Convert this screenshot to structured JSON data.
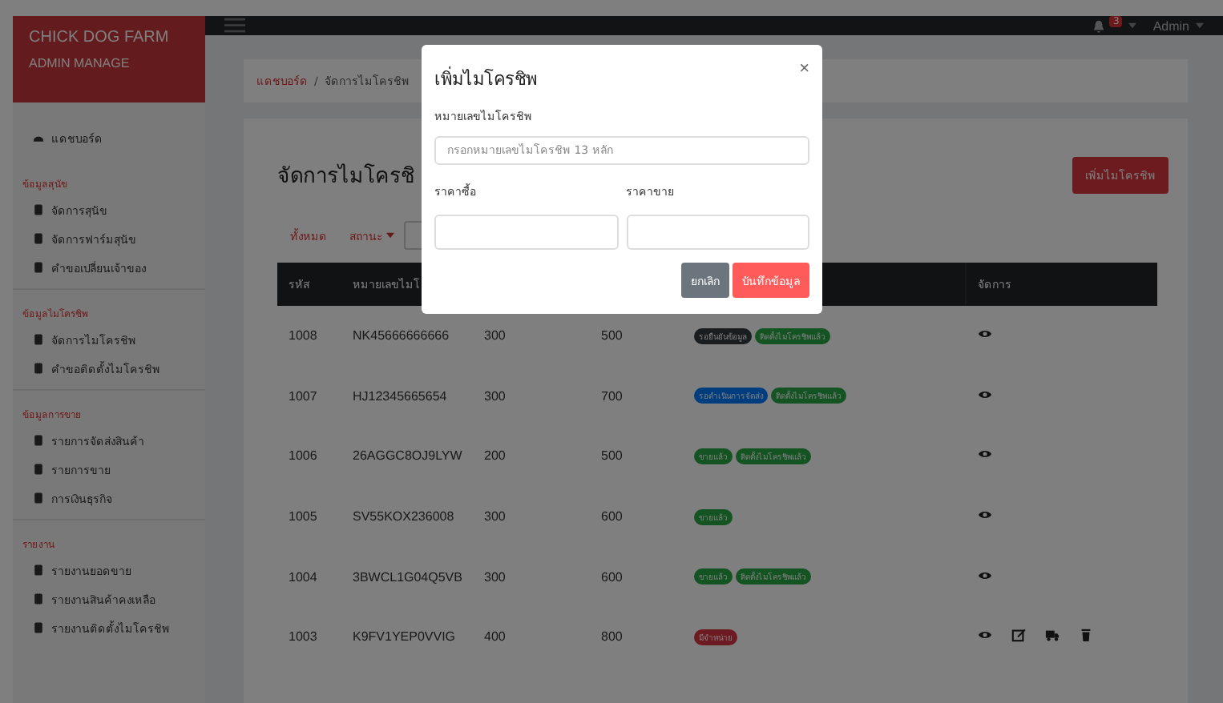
{
  "brand": {
    "title": "CHICK DOG FARM",
    "subtitle": "ADMIN MANAGE"
  },
  "sidebar": {
    "top_item": {
      "label": "แดชบอร์ด"
    },
    "sections": [
      {
        "heading": "ข้อมูลสุนัข",
        "items": [
          {
            "label": "จัดการสุนัข"
          },
          {
            "label": "จัดการฟาร์มสุนัข"
          },
          {
            "label": "คำขอเปลี่ยนเจ้าของ"
          }
        ]
      },
      {
        "heading": "ข้อมูลไมโครชิพ",
        "items": [
          {
            "label": "จัดการไมโครชิพ"
          },
          {
            "label": "คำขอติดตั้งไมโครชิพ"
          }
        ]
      },
      {
        "heading": "ข้อมูลการขาย",
        "items": [
          {
            "label": "รายการจัดส่งสินค้า"
          },
          {
            "label": "รายการขาย"
          },
          {
            "label": "การเงินธุรกิจ"
          }
        ]
      },
      {
        "heading": "รายงาน",
        "items": [
          {
            "label": "รายงานยอดขาย"
          },
          {
            "label": "รายงานสินค้าคงเหลือ"
          },
          {
            "label": "รายงานติดตั้งไมโครชิพ"
          }
        ]
      }
    ]
  },
  "topbar": {
    "notification_count": "3",
    "user": "Admin"
  },
  "breadcrumb": [
    {
      "label": "แดชบอร์ด",
      "link": true
    },
    {
      "separator": "/",
      "label": "จัดการไมโครชิพ",
      "link": false
    }
  ],
  "page": {
    "title": "จัดการไมโครชิ",
    "add_button": "เพิ่มไมโครชิพ",
    "filters": [
      {
        "label": "ทั้งหมด",
        "dropdown": false
      },
      {
        "label": "สถานะ",
        "dropdown": true
      }
    ]
  },
  "table": {
    "columns": [
      "รหัส",
      "หมายเลขไมโ",
      "",
      "",
      "",
      "จัดการ"
    ],
    "rows": [
      {
        "id": "1008",
        "chip": "NK45666666666",
        "buy": "300",
        "sell": "500",
        "badges": [
          {
            "label": "รอยืนยันข้อมูล",
            "color": "#1a1d20"
          },
          {
            "label": "ติดตั้งไมโครชิพแล้ว",
            "color": "#145322"
          }
        ],
        "actions": [
          {
            "kind": "view"
          }
        ]
      },
      {
        "id": "1007",
        "chip": "HJ12345665654",
        "buy": "300",
        "sell": "700",
        "badges": [
          {
            "label": "รอดำเนินการจัดส่ง",
            "color": "#003d7f"
          },
          {
            "label": "ติดตั้งไมโครชิพแล้ว",
            "color": "#145322"
          }
        ],
        "actions": [
          {
            "kind": "view"
          }
        ]
      },
      {
        "id": "1006",
        "chip": "26AGGC8OJ9LYW",
        "buy": "200",
        "sell": "500",
        "badges": [
          {
            "label": "ขายแล้ว",
            "color": "#145322"
          },
          {
            "label": "ติดตั้งไมโครชิพแล้ว",
            "color": "#145322"
          }
        ],
        "actions": [
          {
            "kind": "view"
          }
        ]
      },
      {
        "id": "1005",
        "chip": "SV55KOX236008",
        "buy": "300",
        "sell": "600",
        "badges": [
          {
            "label": "ขายแล้ว",
            "color": "#145322"
          }
        ],
        "actions": [
          {
            "kind": "view"
          }
        ]
      },
      {
        "id": "1004",
        "chip": "3BWCL1G04Q5VB",
        "buy": "300",
        "sell": "600",
        "badges": [
          {
            "label": "ขายแล้ว",
            "color": "#145322"
          },
          {
            "label": "ติดตั้งไมโครชิพแล้ว",
            "color": "#145322"
          }
        ],
        "actions": [
          {
            "kind": "view"
          }
        ]
      },
      {
        "id": "1003",
        "chip": "K9FV1YEP0VVIG",
        "buy": "400",
        "sell": "800",
        "badges": [
          {
            "label": "มีจำหน่าย",
            "color": "#6e1a22"
          }
        ],
        "actions": [
          {
            "kind": "view"
          },
          {
            "kind": "edit"
          },
          {
            "kind": "ship"
          },
          {
            "kind": "delete"
          }
        ]
      }
    ]
  },
  "modal": {
    "title": "เพิ่มไมโครชิพ",
    "close": "×",
    "chip_label": "หมายเลขไมโครชิพ",
    "chip_placeholder": "กรอกหมายเลขไมโครชิพ 13 หลัก",
    "buy_label": "ราคาซื้อ",
    "sell_label": "ราคาขาย",
    "cancel": "ยกเลิก",
    "save": "บันทึกข้อมูล"
  }
}
